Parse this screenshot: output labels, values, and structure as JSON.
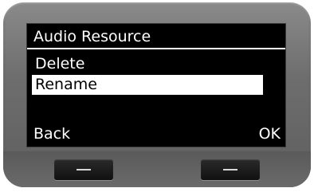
{
  "screen": {
    "title": "Audio Resource",
    "menu_items": [
      {
        "label": "Delete",
        "selected": false
      },
      {
        "label": "Rename",
        "selected": true
      }
    ],
    "softkeys": {
      "left": "Back",
      "right": "OK"
    }
  },
  "hardware_buttons": [
    {
      "icon": "dash-icon"
    },
    {
      "icon": "dash-icon"
    }
  ],
  "colors": {
    "screen_background": "#000000",
    "screen_text": "#ffffff",
    "selection_background": "#ffffff",
    "device_body": "#6e6e6e"
  }
}
